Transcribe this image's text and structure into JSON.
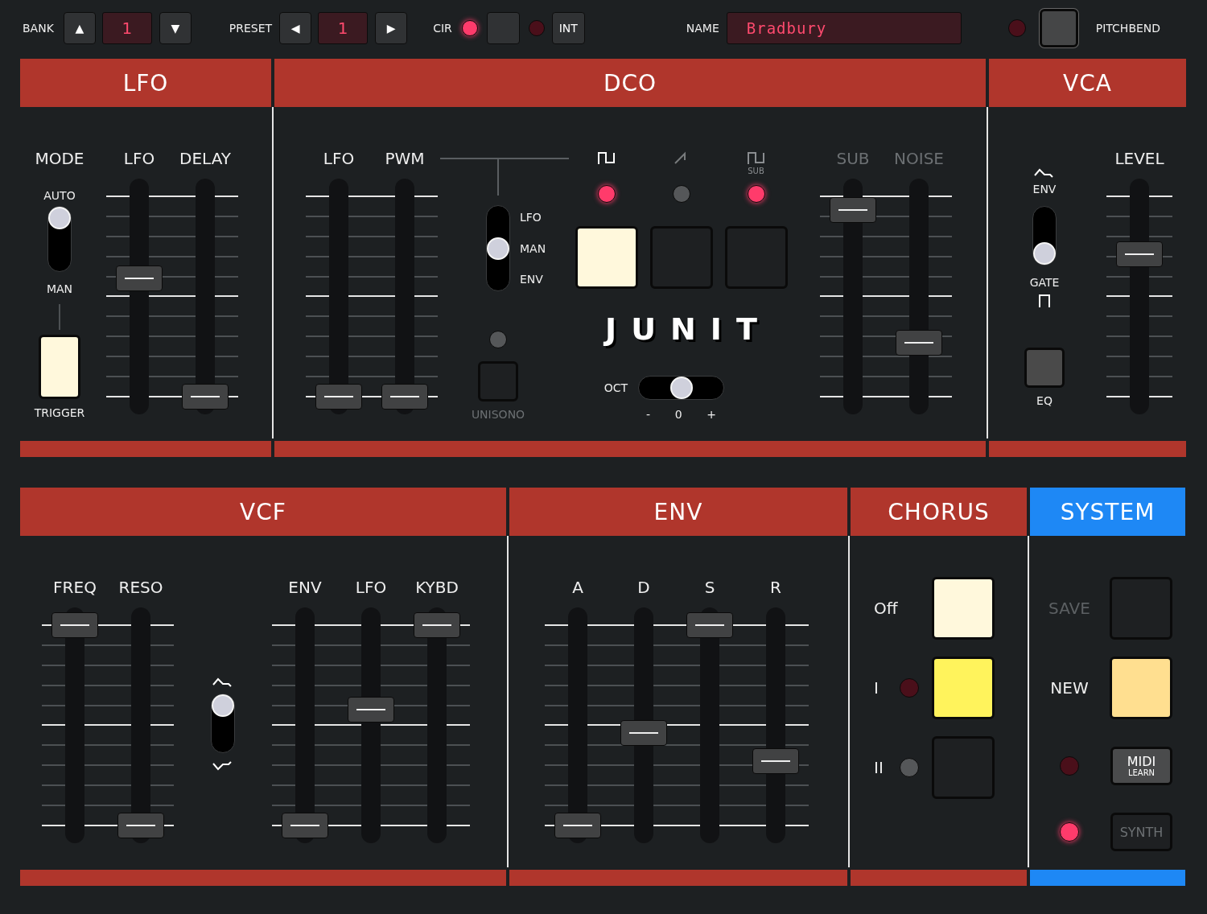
{
  "top_bar": {
    "bank": {
      "label": "BANK",
      "up": "▲",
      "value": "1",
      "down": "▼"
    },
    "preset": {
      "label": "PRESET",
      "prev": "◀",
      "value": "1",
      "next": "▶"
    },
    "clock": {
      "label": "CIR",
      "led_lit": true
    },
    "internal": {
      "label": "INT",
      "led_lit": false
    },
    "name": {
      "label": "NAME",
      "value": "Bradbury"
    },
    "pitchbend": {
      "led_lit": false,
      "label": "PITCHBEND"
    }
  },
  "rows": [
    {
      "sections": [
        {
          "kind": "lfo",
          "title": "LFO",
          "color": "#b0362c",
          "mode": {
            "label": "MODE",
            "level": 1,
            "options": [
              {
                "label": "AUTO"
              },
              {
                "label": "MAN"
              }
            ]
          },
          "trigger": {
            "label": "TRIGGER",
            "color": "#fff8dc"
          },
          "faders": [
            {
              "label": "LFO",
              "level": 0.59
            },
            {
              "label": "DELAY",
              "level": 0
            }
          ]
        },
        {
          "kind": "dco",
          "title": "DCO",
          "color": "#b0362c",
          "faders": [
            {
              "label": "LFO",
              "level": 0
            },
            {
              "label": "PWM",
              "level": 0
            }
          ],
          "mod_source": {
            "level": 0.5,
            "options": [
              {
                "label": "LFO"
              },
              {
                "label": "MAN"
              },
              {
                "label": "ENV"
              }
            ]
          },
          "unison": {
            "label": "UNISONO",
            "led_lit": false,
            "led_disabled": true,
            "color": "#1e2022",
            "disabled": true
          },
          "waves": [
            {
              "kind": "pulse",
              "led_lit": true,
              "led_disabled": false,
              "color": "#fff8dc"
            },
            {
              "kind": "saw",
              "led_lit": false,
              "led_disabled": true,
              "color": "#1e2022"
            },
            {
              "kind": "square",
              "sublabel": "SUB",
              "led_lit": true,
              "led_disabled": false,
              "color": "#1e2022"
            }
          ],
          "logo": "JUNIT",
          "octave": {
            "label": "OCT",
            "level": 0.5,
            "options": [
              {
                "label": "-"
              },
              {
                "label": "0"
              },
              {
                "label": "+"
              }
            ]
          },
          "mix_faders": [
            {
              "label": "SUB",
              "level": 0.93,
              "disabled": true
            },
            {
              "label": "NOISE",
              "level": 0.27,
              "disabled": true
            }
          ]
        },
        {
          "kind": "vca",
          "title": "VCA",
          "color": "#b0362c",
          "mode": {
            "level": 0,
            "options": [
              {
                "kind": "env",
                "label": "ENV"
              },
              {
                "kind": "gate",
                "label": "GATE"
              }
            ]
          },
          "eq": {
            "label": "EQ",
            "color": "#4a4a4a"
          },
          "faders": [
            {
              "label": "LEVEL",
              "level": 0.71
            }
          ]
        }
      ]
    },
    {
      "sections": [
        {
          "kind": "vcf",
          "title": "VCF",
          "color": "#b0362c",
          "faders": [
            {
              "label": "FREQ",
              "level": 1
            },
            {
              "label": "RESO",
              "level": 0
            }
          ],
          "polarity": {
            "level": 1,
            "options": [
              {
                "kind": "positive"
              },
              {
                "kind": "negative"
              }
            ]
          },
          "mod_faders": [
            {
              "label": "ENV",
              "level": 0
            },
            {
              "label": "LFO",
              "level": 0.58
            },
            {
              "label": "KYBD",
              "level": 1
            }
          ]
        },
        {
          "kind": "env",
          "title": "ENV",
          "color": "#b0362c",
          "faders": [
            {
              "label": "A",
              "level": 0
            },
            {
              "label": "D",
              "level": 0.46
            },
            {
              "label": "S",
              "level": 1
            },
            {
              "label": "R",
              "level": 0.32
            }
          ]
        },
        {
          "kind": "chorus",
          "title": "CHORUS",
          "color": "#b0362c",
          "modes": [
            {
              "label": "Off",
              "color": "#fff8dc"
            },
            {
              "label": "I",
              "led_lit": false,
              "led_disabled": false,
              "color": "#fff35c"
            },
            {
              "label": "II",
              "led_lit": false,
              "led_disabled": true,
              "color": "#1e2022"
            }
          ]
        },
        {
          "kind": "system",
          "title": "SYSTEM",
          "color": "#1e88f5",
          "items": [
            {
              "kind": "pad",
              "label": "SAVE",
              "disabled": true,
              "color": "#1e2022"
            },
            {
              "kind": "pad",
              "label": "NEW",
              "disabled": false,
              "color": "#ffdf90"
            },
            {
              "kind": "button",
              "label": "MIDI",
              "sublabel": "LEARN",
              "led_lit": false,
              "disabled": false
            },
            {
              "kind": "button",
              "label": "SYNTH",
              "led_lit": true,
              "disabled": true
            }
          ]
        }
      ]
    }
  ]
}
